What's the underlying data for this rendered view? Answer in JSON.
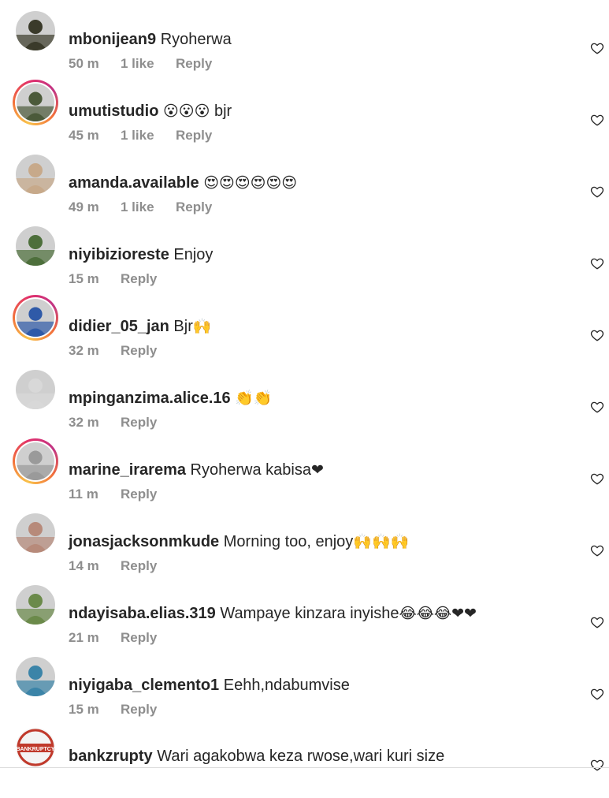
{
  "comments": [
    {
      "username": "mbonijean9",
      "text": "Ryoherwa",
      "emoji": "",
      "time": "50 m",
      "likes": "1 like",
      "reply": "Reply",
      "ring": false,
      "avatar_color": "#3a3a2a"
    },
    {
      "username": "umutistudio",
      "text": "",
      "emoji": "😮😮😮",
      "text_after": "bjr",
      "time": "45 m",
      "likes": "1 like",
      "reply": "Reply",
      "ring": true,
      "avatar_color": "#4b5a3a"
    },
    {
      "username": "amanda.available",
      "text": "",
      "emoji": "😍😍😍😍😍😍",
      "time": "49 m",
      "likes": "1 like",
      "reply": "Reply",
      "ring": false,
      "avatar_color": "#c7a98a"
    },
    {
      "username": "niyibizioreste",
      "text": "Enjoy",
      "emoji": "",
      "time": "15 m",
      "likes": "",
      "reply": "Reply",
      "ring": false,
      "avatar_color": "#4d6f3b"
    },
    {
      "username": "didier_05_jan",
      "text": "Bjr",
      "emoji": "🙌",
      "time": "32 m",
      "likes": "",
      "reply": "Reply",
      "ring": true,
      "avatar_color": "#2f5aa8"
    },
    {
      "username": "mpinganzima.alice.16",
      "text": "",
      "emoji": "👏👏",
      "time": "32 m",
      "likes": "",
      "reply": "Reply",
      "ring": false,
      "avatar_color": "#d8d8d8"
    },
    {
      "username": "marine_irarema",
      "text": "Ryoherwa kabisa",
      "emoji": "❤",
      "time": "11 m",
      "likes": "",
      "reply": "Reply",
      "ring": true,
      "avatar_color": "#9a9a9a"
    },
    {
      "username": "jonasjacksonmkude",
      "text": "Morning too, enjoy",
      "emoji": "🙌🙌🙌",
      "time": "14 m",
      "likes": "",
      "reply": "Reply",
      "ring": false,
      "avatar_color": "#b78a7a"
    },
    {
      "username": "ndayisaba.elias.319",
      "text": "Wampaye kinzara inyishe",
      "emoji": "😂😂😂❤❤",
      "time": "21 m",
      "likes": "",
      "reply": "Reply",
      "ring": false,
      "avatar_color": "#6b8a4a"
    },
    {
      "username": "niyigaba_clemento1",
      "text": "Eehh,ndabumvise",
      "emoji": "",
      "time": "15 m",
      "likes": "",
      "reply": "Reply",
      "ring": false,
      "avatar_color": "#3b84a8"
    },
    {
      "username": "bankzrupty",
      "text": "Wari agakobwa keza rwose,wari kuri size",
      "emoji": "",
      "time": "",
      "likes": "",
      "reply": "",
      "ring": false,
      "avatar_color": "#c0392b",
      "avatar_text": "BANKRUPTCY"
    }
  ],
  "icons": {
    "heart": "heart-outline-icon"
  },
  "colors": {
    "text": "#262626",
    "meta": "#8e8e8e",
    "divider": "#dbdbdb"
  }
}
